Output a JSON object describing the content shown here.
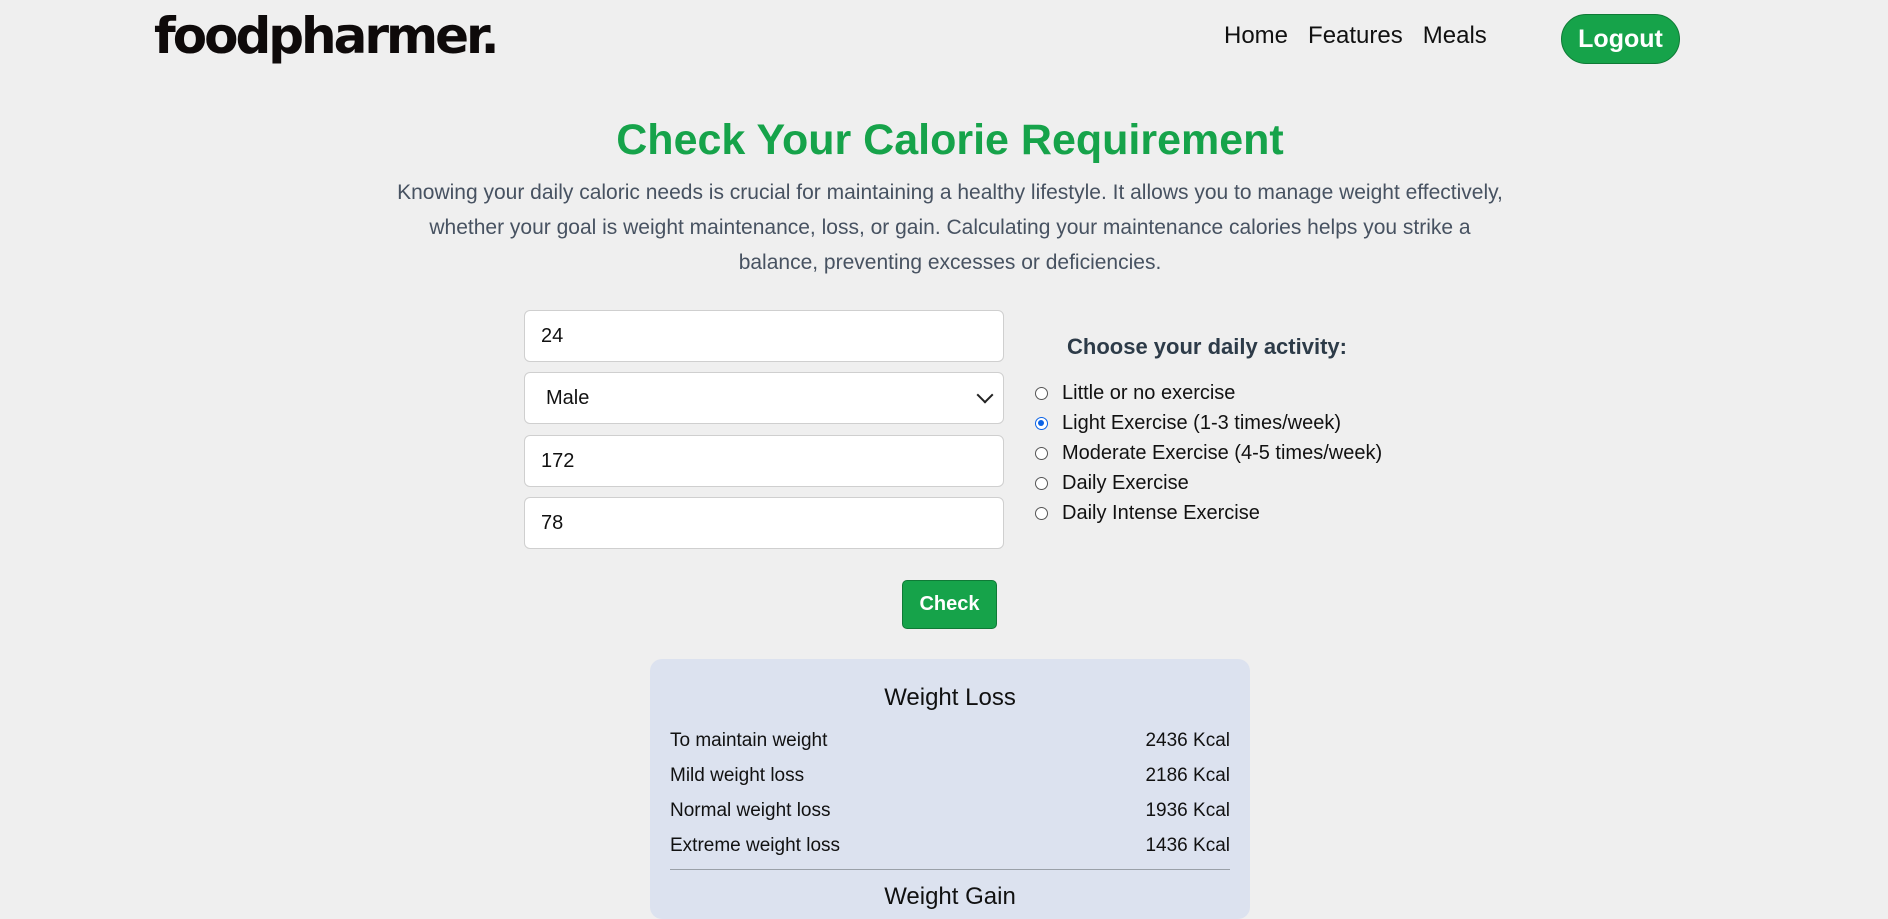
{
  "header": {
    "logo": "foodpharmer.",
    "nav": [
      "Home",
      "Features",
      "Meals"
    ],
    "logout_label": "Logout"
  },
  "main": {
    "title": "Check Your Calorie Requirement",
    "intro": "Knowing your daily caloric needs is crucial for maintaining a healthy lifestyle. It allows you to manage weight effectively, whether your goal is weight maintenance, loss, or gain. Calculating your maintenance calories helps you strike a balance, preventing excesses or deficiencies."
  },
  "form": {
    "age": "24",
    "gender": "Male",
    "height": "172",
    "weight": "78",
    "check_label": "Check"
  },
  "activity": {
    "heading": "Choose your daily activity:",
    "options": [
      {
        "label": "Little or no exercise",
        "checked": false
      },
      {
        "label": "Light Exercise (1-3 times/week)",
        "checked": true
      },
      {
        "label": "Moderate Exercise (4-5 times/week)",
        "checked": false
      },
      {
        "label": "Daily Exercise",
        "checked": false
      },
      {
        "label": "Daily Intense Exercise",
        "checked": false
      }
    ]
  },
  "results": {
    "weight_loss_title": "Weight Loss",
    "weight_loss_rows": [
      {
        "label": "To maintain weight",
        "value": "2436 Kcal"
      },
      {
        "label": "Mild weight loss",
        "value": "2186 Kcal"
      },
      {
        "label": "Normal weight loss",
        "value": "1936 Kcal"
      },
      {
        "label": "Extreme weight loss",
        "value": "1436 Kcal"
      }
    ],
    "weight_gain_title": "Weight Gain"
  },
  "colors": {
    "accent": "#16a34a",
    "background": "#efefef",
    "results_panel": "#dce2ef",
    "intro_text": "#475261"
  }
}
